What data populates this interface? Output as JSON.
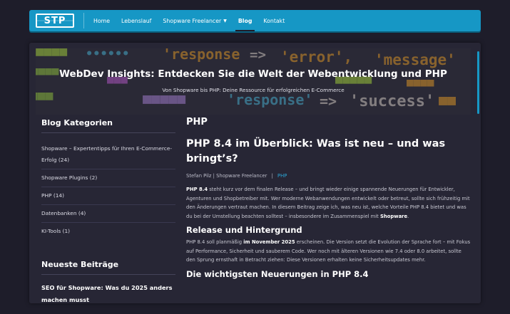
{
  "nav": {
    "logo_text": "STP",
    "items": [
      "Home",
      "Lebenslauf",
      "Shopware Freelancer",
      "Blog",
      "Kontakt"
    ],
    "active": "Blog"
  },
  "hero": {
    "title": "WebDev Insights: Entdecken Sie die Welt der Webentwicklung und PHP",
    "subtitle": "Von Shopware bis PHP: Deine Ressource für erfolgreichen E-Commerce"
  },
  "sidebar": {
    "categories_heading": "Blog Kategorien",
    "categories": [
      "Shopware – Expertentipps für Ihren E-Commerce-Erfolg (24)",
      "Shopware Plugins (2)",
      "PHP (14)",
      "Datenbanken (4)",
      "KI-Tools (1)"
    ],
    "recent_heading": "Neueste Beiträge",
    "recent_post": "SEO für Shopware: Was du 2025 anders machen musst"
  },
  "main": {
    "category_title": "PHP",
    "post_title": "PHP 8.4 im Überblick: Was ist neu – und was bringt’s?",
    "author": "Stefan Pilz | Shopware Freelancer",
    "separator": "|",
    "tag": "PHP",
    "intro_bold": "PHP 8.4",
    "intro_rest": " steht kurz vor dem finalen Release – und bringt wieder einige spannende Neuerungen für Entwickler, Agenturen und Shopbetreiber mit. Wer moderne Webanwendungen entwickelt oder betreut, sollte sich frühzeitig mit den Änderungen vertraut machen. In diesem Beitrag zeige ich, was neu ist, welche Vorteile PHP 8.4 bietet und was du bei der Umstellung beachten solltest – insbesondere im Zusammenspiel mit ",
    "intro_end_bold": "Shopware",
    "intro_end": ".",
    "section1_heading": "Release und Hintergrund",
    "section1_a": "PHP 8.4 soll planmäßig ",
    "section1_bold": "im November 2025",
    "section1_b": " erscheinen. Die Version setzt die Evolution der Sprache fort – mit Fokus auf Performance, Sicherheit und sauberem Code. Wer noch mit älteren Versionen wie 7.4 oder 8.0 arbeitet, sollte den Sprung ernsthaft in Betracht ziehen: Diese Versionen erhalten keine Sicherheitsupdates mehr.",
    "section2_heading": "Die wichtigsten Neuerungen in PHP 8.4"
  },
  "colors": {
    "accent": "#1697c5",
    "background": "#1e1d2a",
    "card": "#272635"
  }
}
